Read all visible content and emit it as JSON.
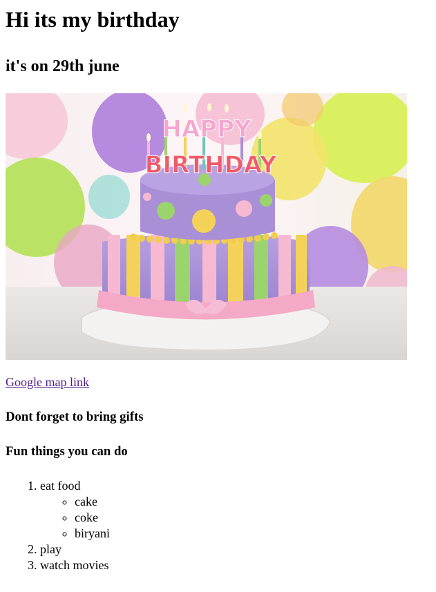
{
  "heading": "Hi its my birthday",
  "subheading": "it's on 29th june",
  "image": {
    "banner_line1": "HAPPY",
    "banner_line2": "BIRTHDAY",
    "colors": {
      "lilac": "#a98fd6",
      "pink": "#f7b9d2",
      "yellow": "#f4d25a",
      "green": "#9bd36c",
      "teal": "#6fc7b4"
    }
  },
  "map_link": "Google map link",
  "gifts_note": "Dont forget to bring gifts",
  "fun_heading": "Fun things you can do",
  "fun_list": [
    {
      "label": "eat food",
      "sub": [
        "cake",
        "coke",
        "biryani"
      ]
    },
    {
      "label": "play"
    },
    {
      "label": "watch movies"
    }
  ]
}
